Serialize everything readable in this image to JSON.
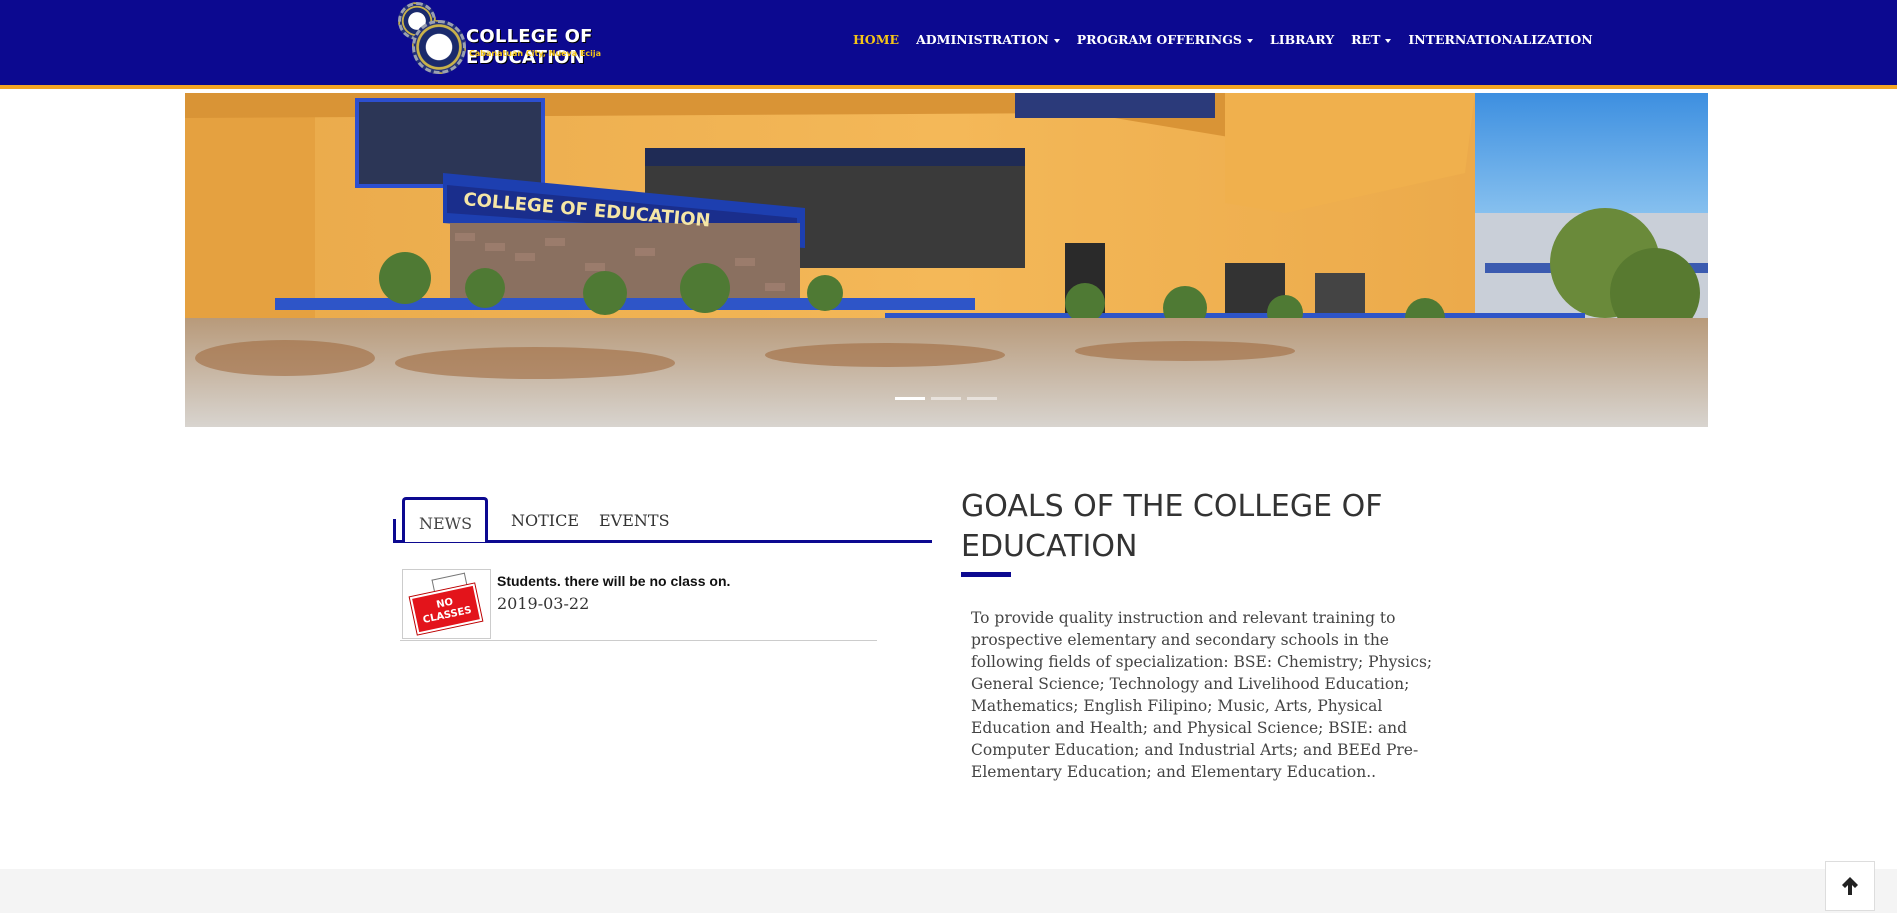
{
  "header": {
    "brand_title": "COLLEGE OF EDUCATION",
    "brand_subtitle": "Cabanatuan City, Nueva Ecija",
    "nav": [
      {
        "label": "HOME",
        "active": true,
        "dropdown": false
      },
      {
        "label": "ADMINISTRATION",
        "active": false,
        "dropdown": true
      },
      {
        "label": "PROGRAM OFFERINGS",
        "active": false,
        "dropdown": true
      },
      {
        "label": "LIBRARY",
        "active": false,
        "dropdown": false
      },
      {
        "label": "RET",
        "active": false,
        "dropdown": true
      },
      {
        "label": "INTERNATIONALIZATION",
        "active": false,
        "dropdown": false
      }
    ]
  },
  "hero": {
    "sign_text": "COLLEGE OF EDUCATION",
    "slide_count": 3,
    "active_slide": 1
  },
  "tabs": {
    "items": [
      "NEWS",
      "NOTICE",
      "EVENTS"
    ],
    "active": "NEWS"
  },
  "news": [
    {
      "title": "Students. there will be no class on.",
      "date": "2019-03-22",
      "thumb_text": "NO CLASSES"
    }
  ],
  "goals": {
    "title": "GOALS OF THE COLLEGE OF EDUCATION",
    "text": "To provide quality instruction and relevant training to prospective elementary and secondary schools in the following fields of specialization: BSE: Chemistry; Physics; General Science; Technology and Livelihood Education; Mathematics; English Filipino; Music, Arts, Physical Education and Health; and Physical Science; BSIE: and Computer Education; and Industrial Arts; and BEEd Pre-Elementary Education; and Elementary Education.."
  },
  "icons": {
    "back_to_top": "arrow-up-icon"
  },
  "colors": {
    "nav_bg": "#0c0990",
    "nav_accent": "#f5a623",
    "active_link": "#f5c518"
  }
}
